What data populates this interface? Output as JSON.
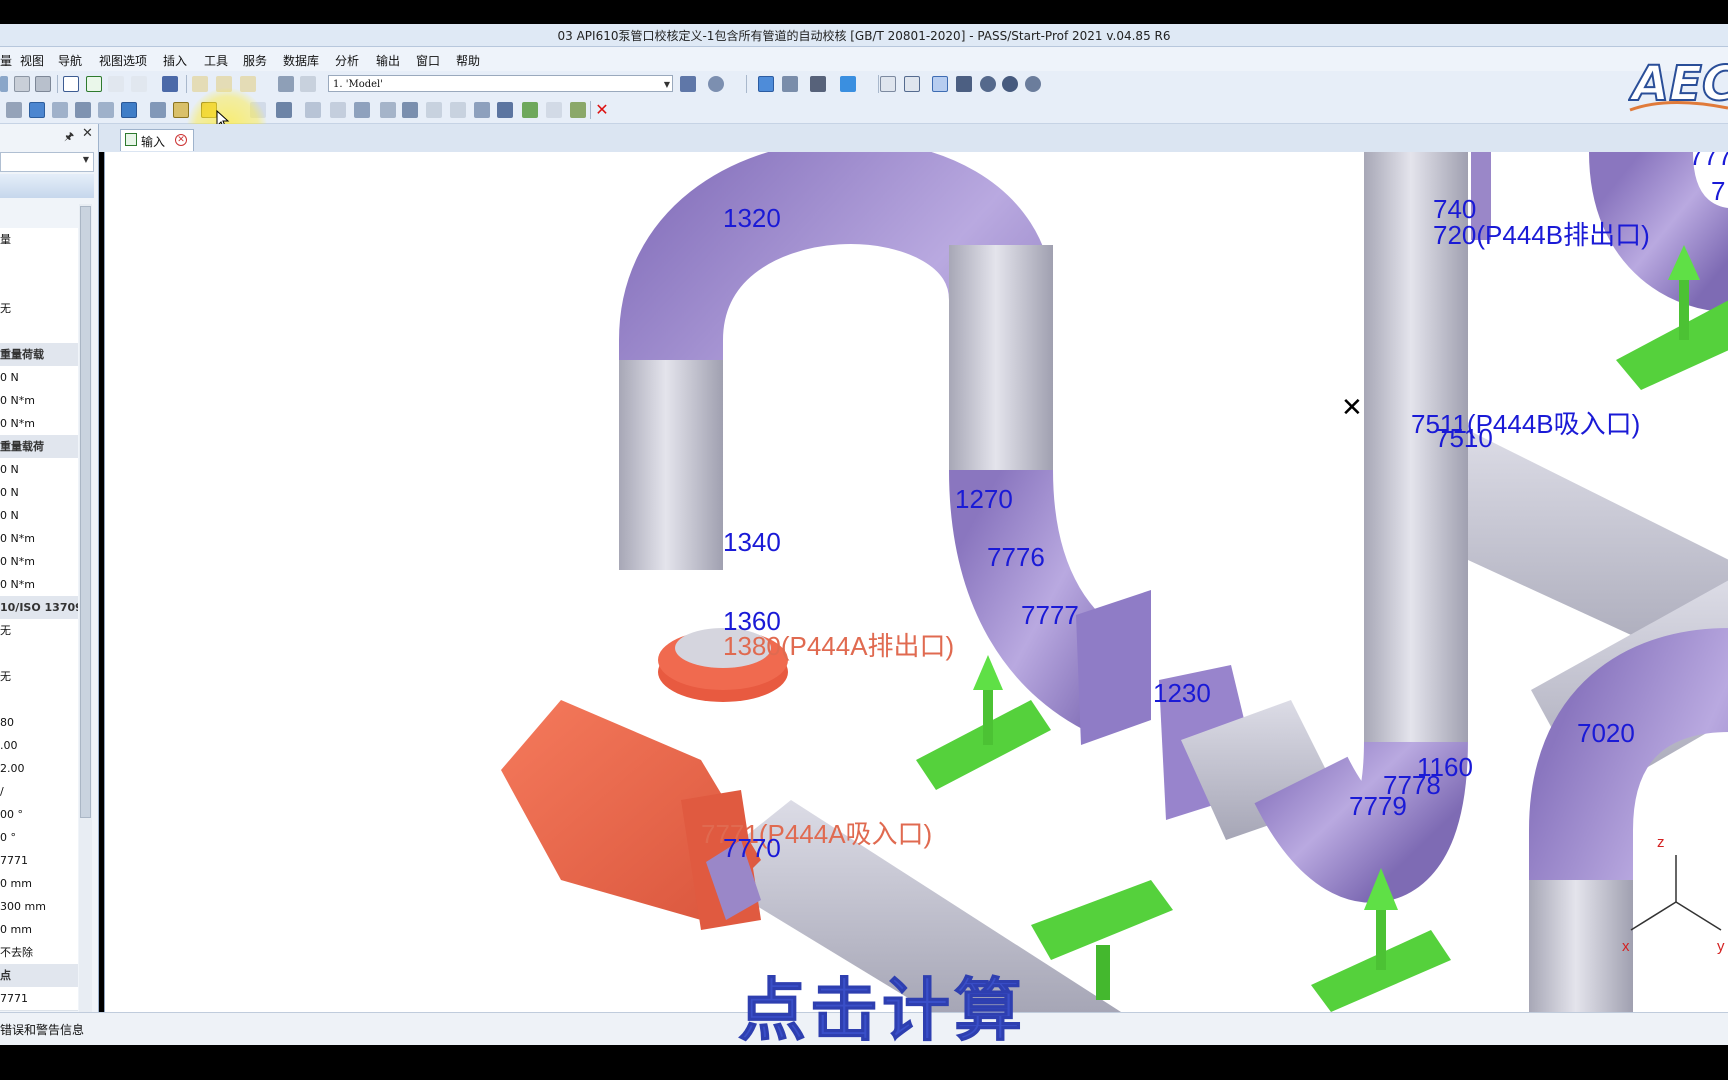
{
  "window": {
    "title": "03 API610泵管口校核定义-1包含所有管道的自动校核 [GB/T 20801-2020] - PASS/Start-Prof 2021 v.04.85 R6"
  },
  "menu": [
    {
      "label": "量"
    },
    {
      "label": "视图"
    },
    {
      "label": "导航"
    },
    {
      "label": "视图选项"
    },
    {
      "label": "插入"
    },
    {
      "label": "工具"
    },
    {
      "label": "服务"
    },
    {
      "label": "数据库"
    },
    {
      "label": "分析"
    },
    {
      "label": "输出"
    },
    {
      "label": "窗口"
    },
    {
      "label": "帮助"
    }
  ],
  "toolbar": {
    "model_selector": "1. 'Model'"
  },
  "tab": {
    "label": "输入"
  },
  "left_panel": {
    "rows": [
      {
        "text": "量",
        "group": false
      },
      {
        "text": "",
        "group": false
      },
      {
        "text": "",
        "group": false
      },
      {
        "text": "无",
        "group": false
      },
      {
        "text": "",
        "group": false
      },
      {
        "text": "重量荷载",
        "group": true
      },
      {
        "text": "0 N",
        "group": false
      },
      {
        "text": "0 N*m",
        "group": false
      },
      {
        "text": "0 N*m",
        "group": false
      },
      {
        "text": "重量载荷",
        "group": true
      },
      {
        "text": "0 N",
        "group": false
      },
      {
        "text": "0 N",
        "group": false
      },
      {
        "text": "0 N",
        "group": false
      },
      {
        "text": "0 N*m",
        "group": false
      },
      {
        "text": "0 N*m",
        "group": false
      },
      {
        "text": "0 N*m",
        "group": false
      },
      {
        "text": "10/ISO 13709",
        "group": true
      },
      {
        "text": "无",
        "group": false
      },
      {
        "text": "",
        "group": false
      },
      {
        "text": "无",
        "group": false
      },
      {
        "text": "",
        "group": false
      },
      {
        "text": "80",
        "group": false
      },
      {
        "text": ".00",
        "group": false
      },
      {
        "text": "2.00",
        "group": false
      },
      {
        "text": "/",
        "group": false
      },
      {
        "text": "00 °",
        "group": false
      },
      {
        "text": "0 °",
        "group": false
      },
      {
        "text": "7771",
        "group": false
      },
      {
        "text": "0 mm",
        "group": false
      },
      {
        "text": "300 mm",
        "group": false
      },
      {
        "text": "0 mm",
        "group": false
      },
      {
        "text": "不去除",
        "group": false
      },
      {
        "text": "点",
        "group": true
      },
      {
        "text": "7771",
        "group": false
      }
    ]
  },
  "viewport": {
    "node_labels": [
      {
        "id": "n1320",
        "text": "1320",
        "color": "#1a1ad6"
      },
      {
        "id": "n1340",
        "text": "1340",
        "color": "#1a1ad6"
      },
      {
        "id": "n1360",
        "text": "1360",
        "color": "#1a1ad6"
      },
      {
        "id": "n1380",
        "text": "1380(P444A排出口)",
        "color": "#e06a50"
      },
      {
        "id": "n1270",
        "text": "1270",
        "color": "#1a1ad6"
      },
      {
        "id": "n7776",
        "text": "7776",
        "color": "#1a1ad6"
      },
      {
        "id": "n7777",
        "text": "7777",
        "color": "#1a1ad6"
      },
      {
        "id": "n1230",
        "text": "1230",
        "color": "#1a1ad6"
      },
      {
        "id": "n7771",
        "text": "7771(P444A吸入口)",
        "color": "#e06a50"
      },
      {
        "id": "n7770",
        "text": "7770",
        "color": "#1a1ad6"
      },
      {
        "id": "n740",
        "text": "740",
        "color": "#1a1ad6"
      },
      {
        "id": "n720",
        "text": "720(P444B排出口)",
        "color": "#1a1ad6"
      },
      {
        "id": "n7511",
        "text": "7511(P444B吸入口)",
        "color": "#1a1ad6"
      },
      {
        "id": "n7510",
        "text": "7510",
        "color": "#1a1ad6"
      },
      {
        "id": "n1160",
        "text": "1160",
        "color": "#1a1ad6"
      },
      {
        "id": "n7778",
        "text": "7778",
        "color": "#1a1ad6"
      },
      {
        "id": "n7779",
        "text": "7779",
        "color": "#1a1ad6"
      },
      {
        "id": "n7020",
        "text": "7020",
        "color": "#1a1ad6"
      },
      {
        "id": "n777x",
        "text": "777",
        "color": "#1a1ad6"
      },
      {
        "id": "n7x",
        "text": "7",
        "color": "#1a1ad6"
      }
    ],
    "axes": {
      "z": "z",
      "x": "x",
      "y": "y"
    },
    "colors": {
      "pipe": "#b9b9c6",
      "bend": "#9a87c8",
      "flange": "#f06a4f",
      "support": "#55d13c"
    }
  },
  "status": {
    "text": "错误和警告信息"
  },
  "overlay": {
    "caption": "点击计算"
  }
}
